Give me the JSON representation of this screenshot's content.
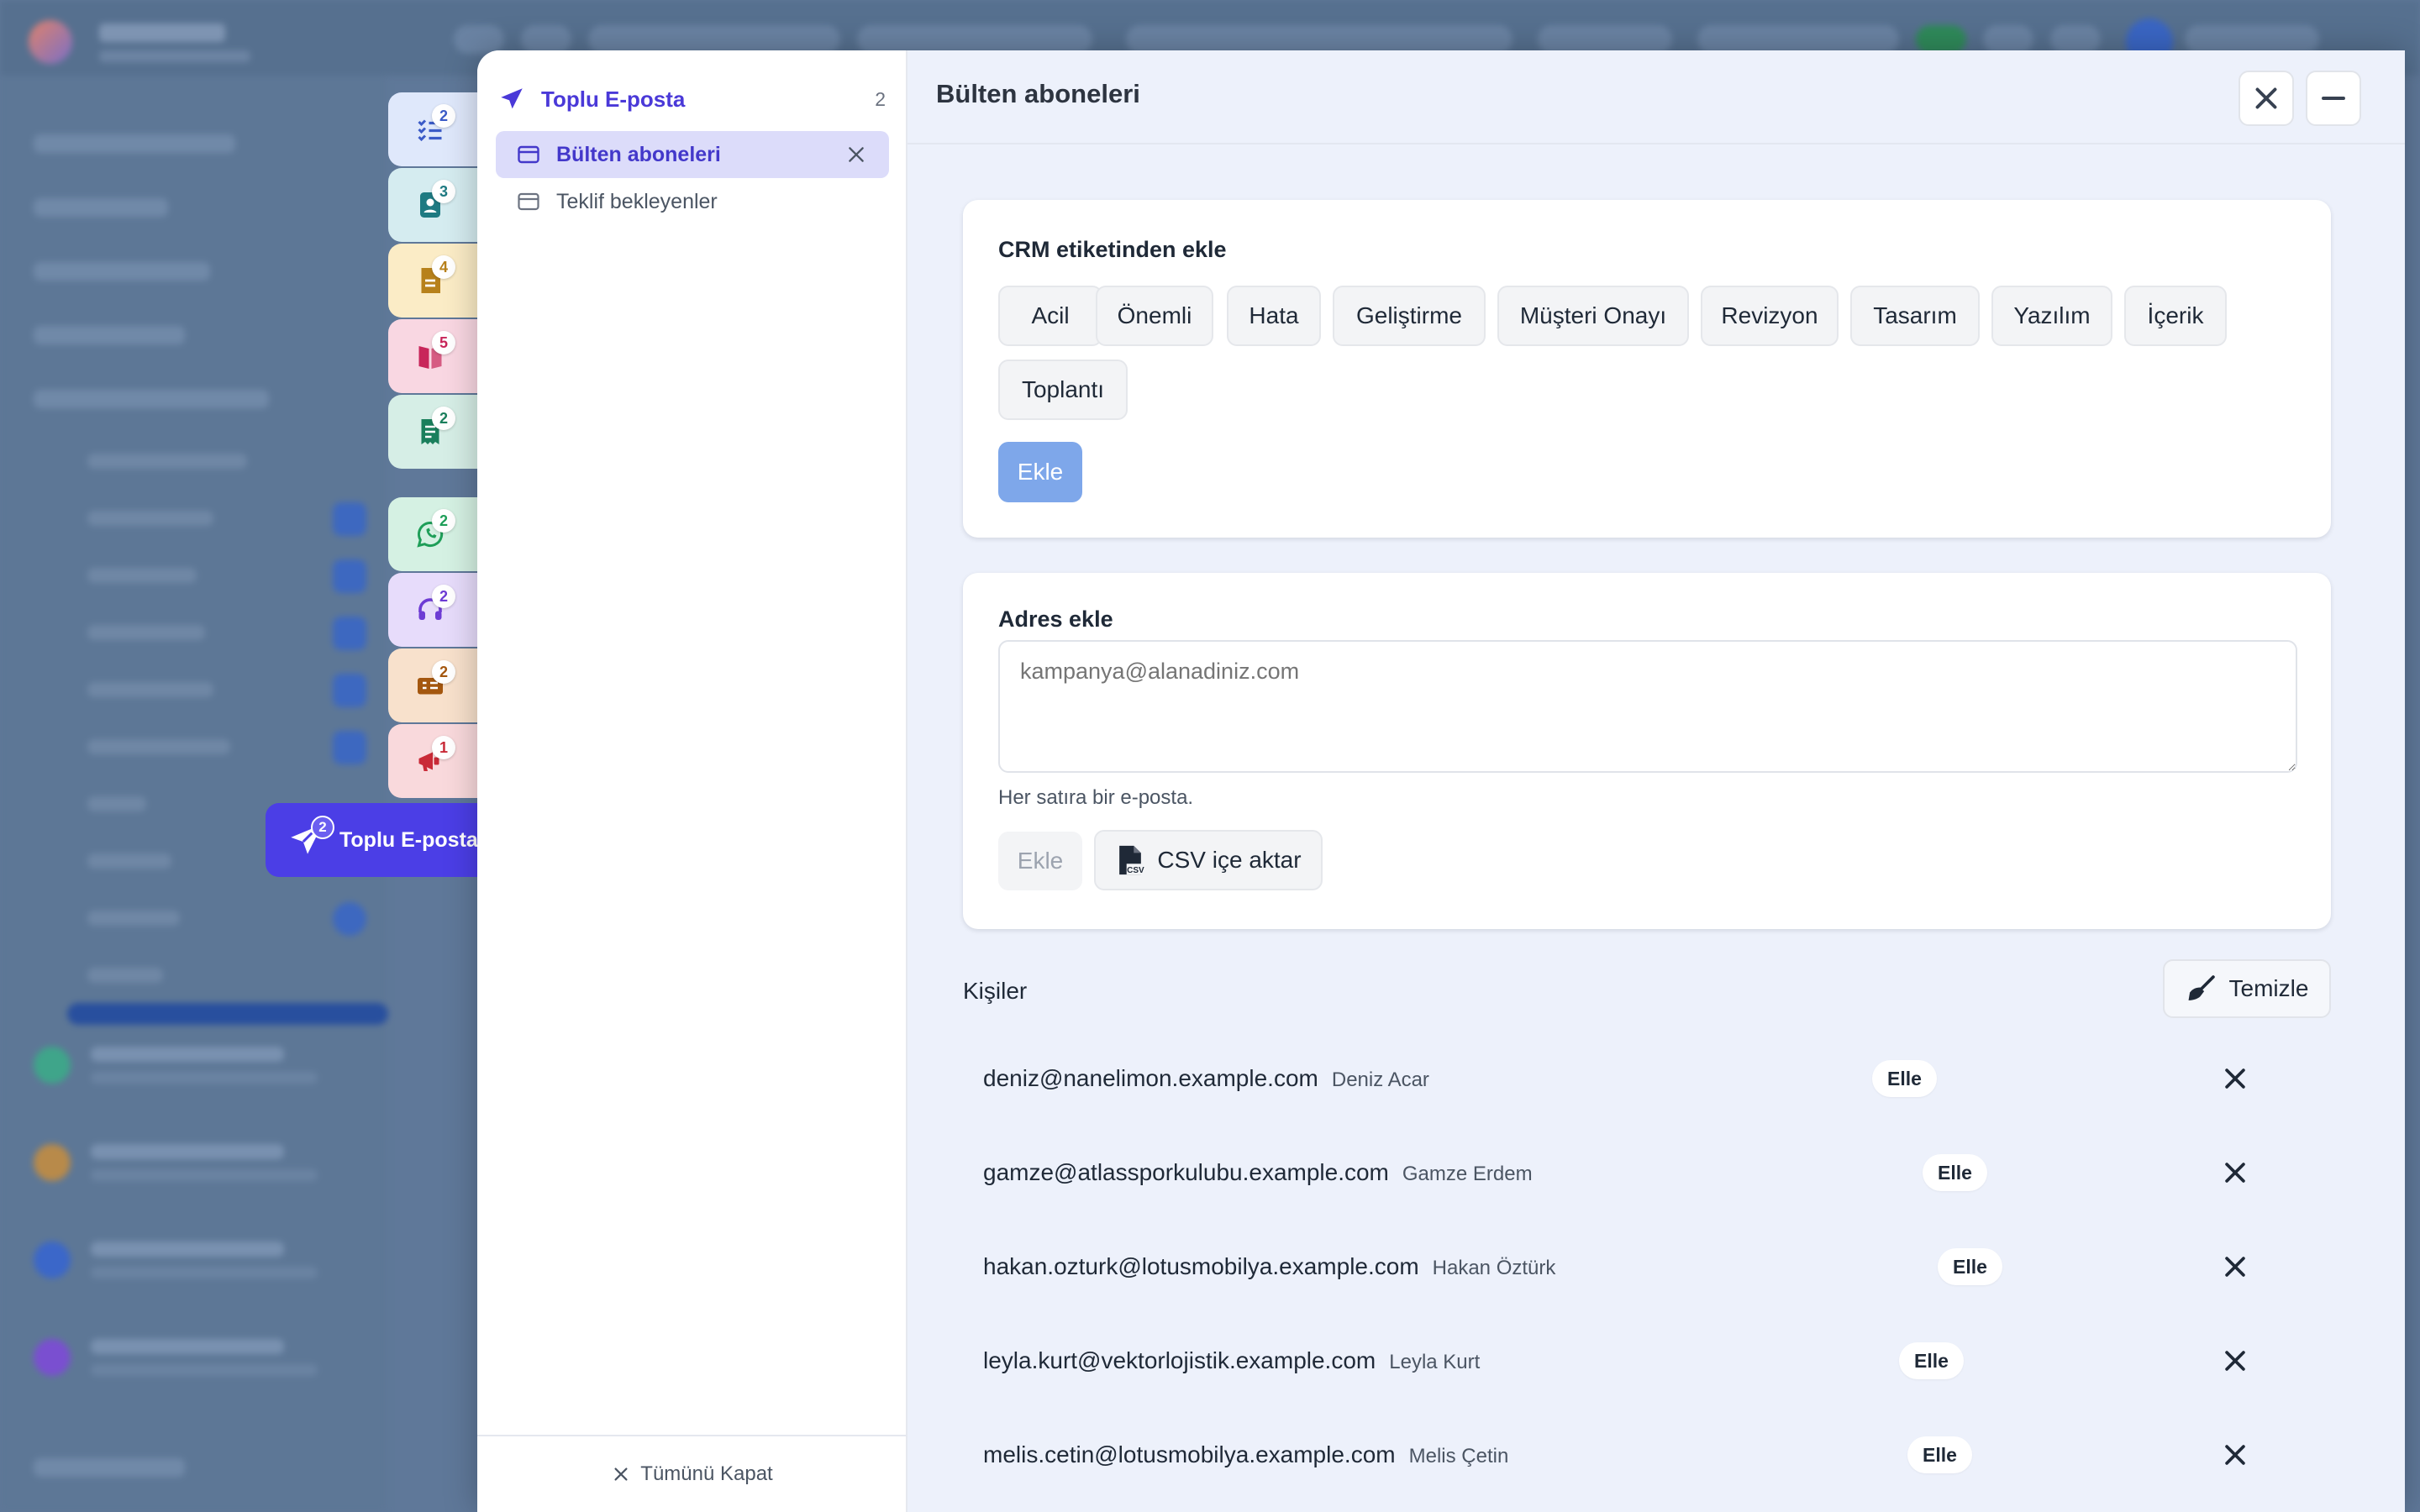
{
  "dock": {
    "tabs": [
      {
        "name": "tasks",
        "badge": "2",
        "bg": "#dfe8fb",
        "color": "#3b5bc7"
      },
      {
        "name": "contacts",
        "badge": "3",
        "bg": "#d5ecf0",
        "color": "#1e7a82"
      },
      {
        "name": "documents",
        "badge": "4",
        "bg": "#fbecc6",
        "color": "#b7811b"
      },
      {
        "name": "books",
        "badge": "5",
        "bg": "#f9d7e2",
        "color": "#c8265a"
      },
      {
        "name": "receipts",
        "badge": "2",
        "bg": "#d6eee6",
        "color": "#1a7f5c"
      },
      {
        "name": "whatsapp",
        "badge": "2",
        "bg": "#d5f1e3",
        "color": "#1e9e58"
      },
      {
        "name": "support",
        "badge": "2",
        "bg": "#e7dcfb",
        "color": "#6d3bd4"
      },
      {
        "name": "tickets",
        "badge": "2",
        "bg": "#f8e1cc",
        "color": "#a4570f"
      },
      {
        "name": "announcements",
        "badge": "1",
        "bg": "#f9d9dc",
        "color": "#c92a37"
      }
    ],
    "active": {
      "label": "Toplu E-posta",
      "badge": "2",
      "icon": "paper-plane-icon"
    }
  },
  "left_panel": {
    "header": "Toplu E-posta",
    "count": "2",
    "items": [
      {
        "label": "Bülten aboneleri",
        "selected": true
      },
      {
        "label": "Teklif bekleyenler",
        "selected": false
      }
    ],
    "footer": "Tümünü Kapat"
  },
  "main": {
    "title": "Bülten aboneleri",
    "crm": {
      "title": "CRM etiketinden ekle",
      "tags": [
        "Acil",
        "Önemli",
        "Hata",
        "Geliştirme",
        "Müşteri Onayı",
        "Revizyon",
        "Tasarım",
        "Yazılım",
        "İçerik",
        "Toplantı"
      ],
      "add_label": "Ekle"
    },
    "address": {
      "title": "Adres ekle",
      "placeholder": "kampanya@alanadiniz.com",
      "hint": "Her satıra bir e-posta.",
      "add_label": "Ekle",
      "csv_label": "CSV içe aktar"
    },
    "contacts": {
      "title": "Kişiler",
      "clear_label": "Temizle",
      "rows": [
        {
          "email": "deniz@nanelimon.example.com",
          "name": "Deniz Acar",
          "source": "Elle"
        },
        {
          "email": "gamze@atlassporkulubu.example.com",
          "name": "Gamze Erdem",
          "source": "Elle"
        },
        {
          "email": "hakan.ozturk@lotusmobilya.example.com",
          "name": "Hakan Öztürk",
          "source": "Elle"
        },
        {
          "email": "leyla.kurt@vektorlojistik.example.com",
          "name": "Leyla Kurt",
          "source": "Elle"
        },
        {
          "email": "melis.cetin@lotusmobilya.example.com",
          "name": "Melis Çetin",
          "source": "Elle"
        }
      ]
    }
  },
  "colors": {
    "accent": "#4b3ee6",
    "primary_button": "#7ea7ea"
  }
}
